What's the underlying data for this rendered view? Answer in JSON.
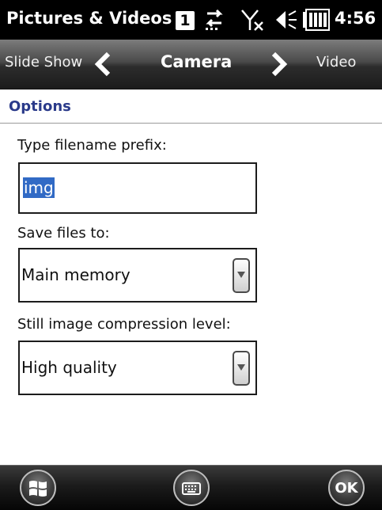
{
  "status_bar": {
    "title": "Pictures & Videos",
    "sim_indicator": "1",
    "clock": "4:56",
    "icons": [
      "data-sync-icon",
      "no-signal-icon",
      "volume-icon",
      "battery-icon"
    ]
  },
  "tabs": {
    "prev": "Slide Show",
    "current": "Camera",
    "next": "Video",
    "icons": [
      "chevron-left-icon",
      "chevron-right-icon"
    ]
  },
  "options": {
    "header": "Options",
    "filename_prefix": {
      "label": "Type filename prefix:",
      "value": "img"
    },
    "save_to": {
      "label": "Save files to:",
      "value": "Main memory"
    },
    "compression": {
      "label": "Still image compression level:",
      "value": "High quality"
    }
  },
  "softkeys": {
    "ok": "OK",
    "icons": [
      "windows-start-icon",
      "keyboard-icon"
    ]
  },
  "colors": {
    "header_text": "#2a3a8a",
    "selection": "#316ac5"
  }
}
